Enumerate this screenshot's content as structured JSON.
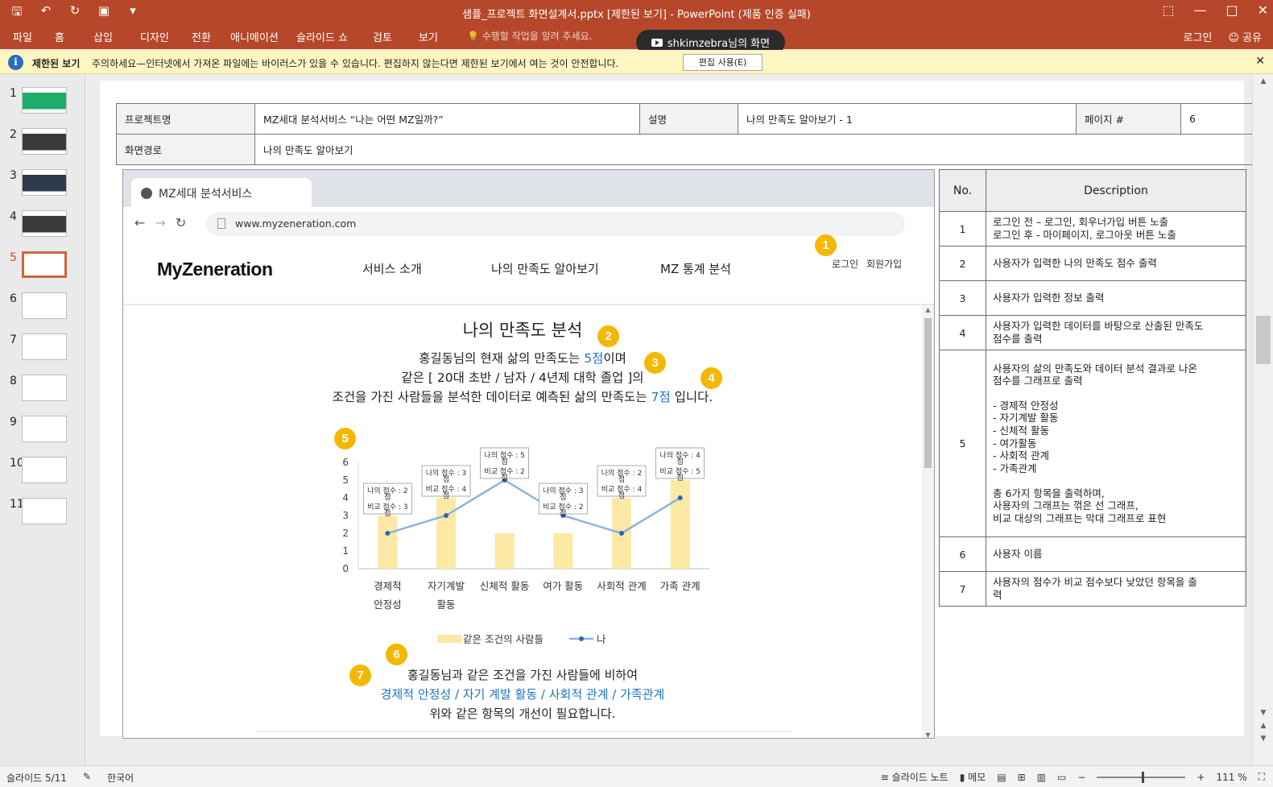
{
  "window": {
    "title": "샘플_프로젝트 화면설계서.pptx [제한된 보기] - PowerPoint (제품 인증 실패)",
    "qat": [
      "save-icon",
      "undo-icon",
      "redo-icon",
      "present-icon",
      "customize-icon"
    ]
  },
  "ribbon": {
    "tabs": [
      "파일",
      "홈",
      "삽입",
      "디자인",
      "전환",
      "애니메이션",
      "슬라이드 쇼",
      "검토",
      "보기"
    ],
    "tellme": "수행할 작업을 알려 주세요.",
    "signin": "로그인",
    "share": "공유"
  },
  "screenshare": {
    "label": "shkimzebra님의 화면"
  },
  "message_bar": {
    "title": "제한된 보기",
    "text": "주의하세요—인터넷에서 가져온 파일에는 바이러스가 있을 수 있습니다. 편집하지 않는다면 제한된 보기에서 여는 것이 안전합니다.",
    "button": "편집 사용(E)"
  },
  "thumbnails": {
    "numbers": [
      "1",
      "2",
      "3",
      "4",
      "5",
      "6",
      "7",
      "8",
      "9",
      "10",
      "11"
    ],
    "selected": "5"
  },
  "slide_header": {
    "project_label": "프로젝트명",
    "project_value": "MZ세대 분석서비스 “나는 어떤 MZ일까?”",
    "desc_label": "설명",
    "desc_value": "나의 만족도 알아보기 - 1",
    "page_label": "페이지 #",
    "page_value": "6",
    "path_label": "화면경로",
    "path_value": "나의 만족도 알아보기"
  },
  "mock": {
    "tab_title": "MZ세대 분석서비스",
    "url": "www.myzeneration.com",
    "logo": "MyZeneration",
    "menu": [
      "서비스 소개",
      "나의 만족도 알아보기",
      "MZ 통계 분석"
    ],
    "login": "로그인",
    "signup": "회원가입",
    "heading": "나의 만족도 분석",
    "line1_pre": "홍길동님의 현재 삶의 만족도는 ",
    "line1_score": "5점",
    "line1_post": "이며",
    "line2": "같은 [ 20대 초반 / 남자 / 4년제 대학 졸업 ]의",
    "line3_pre": "조건을 가진 사람들을 분석한 데이터로 예측된 삶의 만족도는 ",
    "line3_score": "7점",
    "line3_post": " 입니다.",
    "bottom1": "홍길동님과 같은 조건을 가진 사람들에 비하여",
    "bottom2": "경제적 안정성 / 자기 계발 활동 / 사회적 관계 / 가족관계",
    "bottom3": "위와 같은 항목의 개선이 필요합니다.",
    "badges": [
      "1",
      "2",
      "3",
      "4",
      "5",
      "6",
      "7"
    ]
  },
  "chart_data": {
    "type": "bar",
    "categories": [
      "경제적 안정성",
      "자기계발 활동",
      "신체적 활동",
      "여가 활동",
      "사회적 관계",
      "가족 관계"
    ],
    "category_lines": [
      [
        "경제적",
        "안정성"
      ],
      [
        "자기계발",
        "활동"
      ],
      [
        "신체적 활동"
      ],
      [
        "여가 활동"
      ],
      [
        "사회적 관계"
      ],
      [
        "가족 관계"
      ]
    ],
    "series": [
      {
        "name": "같은 조건의 사람들",
        "kind": "bar",
        "values": [
          3,
          4,
          2,
          2,
          4,
          5
        ],
        "color": "#fde9a6"
      },
      {
        "name": "나",
        "kind": "line",
        "values": [
          2,
          3,
          5,
          3,
          2,
          4
        ],
        "color": "#8db3e2"
      }
    ],
    "yticks": [
      "0",
      "1",
      "2",
      "3",
      "4",
      "5",
      "6"
    ],
    "ylim": [
      0,
      6
    ],
    "tooltips": [
      [
        "나의 점수 : 2",
        "점",
        "비교 점수 : 3",
        "점"
      ],
      [
        "나의 점수 : 3",
        "점",
        "비교 점수 : 4",
        "점"
      ],
      [
        "나의 점수 : 5",
        "점",
        "비교 점수 : 2",
        "점"
      ],
      [
        "나의 점수 : 3",
        "점",
        "비교 점수 : 2",
        "점"
      ],
      [
        "나의 점수 : 2",
        "점",
        "비교 점수 : 4",
        "점"
      ],
      [
        "나의 점수 : 4",
        "점",
        "비교 점수 : 5",
        "점"
      ]
    ],
    "legend": "bottom"
  },
  "desc_table": {
    "headers": [
      "No.",
      "Description"
    ],
    "rows": [
      {
        "no": "1",
        "lines": [
          "로그인 전 – 로그인, 회우너가입 버튼 노출",
          "로그인 후 -  마이페이지, 로그아웃 버튼 노출"
        ]
      },
      {
        "no": "2",
        "lines": [
          "사용자가 입력한 나의 만족도 점수 출력"
        ]
      },
      {
        "no": "3",
        "lines": [
          "사용자가 입력한 정보 출력"
        ]
      },
      {
        "no": "4",
        "lines": [
          "사용자가 입력한 데이터를 바탕으로 산출된 만족도",
          "점수를 출력"
        ]
      },
      {
        "no": "5",
        "lines": [
          "사용자의 삶의 만족도와 데이터 분석 결과로 나온",
          "점수를 그래프로 출력",
          " ",
          "-   경제적 안정성",
          "-   자기계발 활동",
          "-   신체적 활동",
          "-   여가활동",
          "-   사회적 관계",
          "-   가족관계",
          " ",
          "총 6가지 항목을 출력하며,",
          "사용자의 그래프는 꺾은 선 그래프,",
          "비교 대상의 그래프는 막대 그래프로 표현"
        ]
      },
      {
        "no": "6",
        "lines": [
          "사용자 이름"
        ]
      },
      {
        "no": "7",
        "lines": [
          "사용자의 점수가 비교 점수보다 낮았던 항목을 출",
          "력"
        ]
      }
    ]
  },
  "status": {
    "slide": "슬라이드 5/11",
    "lang": "한국어",
    "notes": "슬라이드 노트",
    "comments": "메모",
    "zoom": "111 %"
  }
}
